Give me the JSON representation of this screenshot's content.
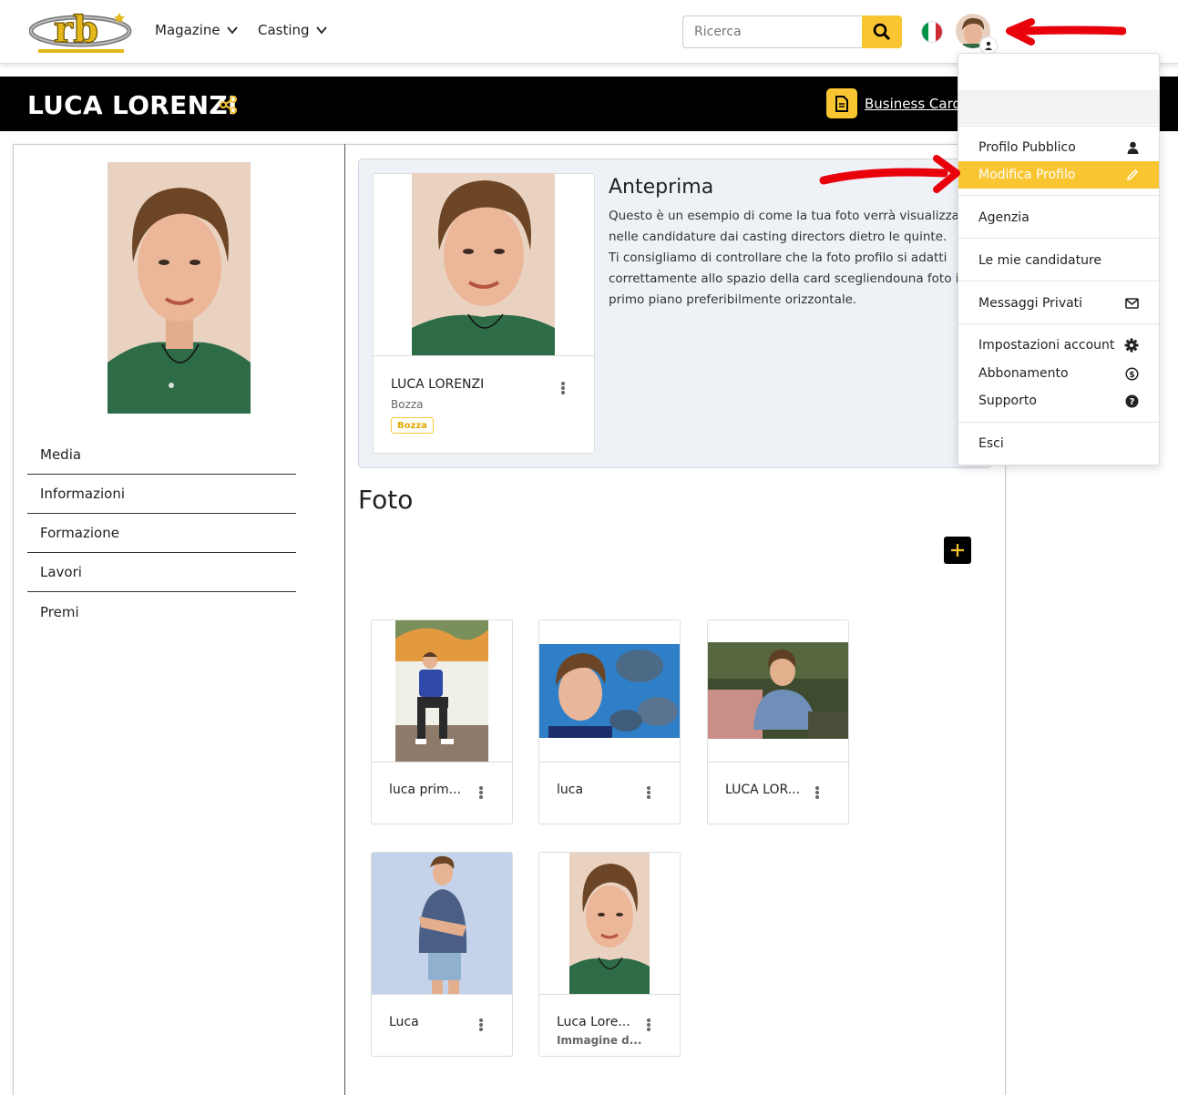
{
  "nav": {
    "magazine_label": "Magazine",
    "casting_label": "Casting",
    "search_placeholder": "Ricerca"
  },
  "colors": {
    "accent": "#f9c531",
    "header_bg": "#000000",
    "arrow": "#e8000b"
  },
  "header": {
    "name": "LUCA LORENZI",
    "business_card_label": "Business Card"
  },
  "sidebar": {
    "items": [
      {
        "label": "Media"
      },
      {
        "label": "Informazioni"
      },
      {
        "label": "Formazione"
      },
      {
        "label": "Lavori"
      },
      {
        "label": "Premi"
      }
    ]
  },
  "preview": {
    "title": "Anteprima",
    "text_lines": [
      "Questo è un esempio di come la tua foto verrà visualizzat",
      "nelle candidature dai casting directors dietro le quinte.",
      "Ti consigliamo di controllare che la foto profilo si adatti",
      "correttamente allo spazio della card scegliendouna foto in",
      "primo piano preferibilmente orizzontale."
    ],
    "card": {
      "name": "LUCA LORENZI",
      "subtitle": "Bozza",
      "badge": "Bozza"
    }
  },
  "foto": {
    "title": "Foto",
    "items": [
      {
        "name": "luca prim...",
        "sub": ""
      },
      {
        "name": "luca",
        "sub": ""
      },
      {
        "name": "LUCA LOR...",
        "sub": ""
      },
      {
        "name": "Luca",
        "sub": ""
      },
      {
        "name": "Luca Lore...",
        "sub": "Immagine d..."
      }
    ]
  },
  "dropdown": {
    "items": [
      {
        "label": "Profilo Pubblico",
        "icon": "person-icon"
      },
      {
        "label": "Modifica Profilo",
        "icon": "pencil-icon",
        "active": true
      },
      {
        "label": "Agenzia",
        "icon": ""
      },
      {
        "label": "Le mie candidature",
        "icon": ""
      },
      {
        "label": "Messaggi Privati",
        "icon": "envelope-icon"
      },
      {
        "label": "Impostazioni account",
        "icon": "gear-icon"
      },
      {
        "label": "Abbonamento",
        "icon": "dollar-circle-icon"
      },
      {
        "label": "Supporto",
        "icon": "question-circle-icon"
      },
      {
        "label": "Esci",
        "icon": ""
      }
    ]
  }
}
